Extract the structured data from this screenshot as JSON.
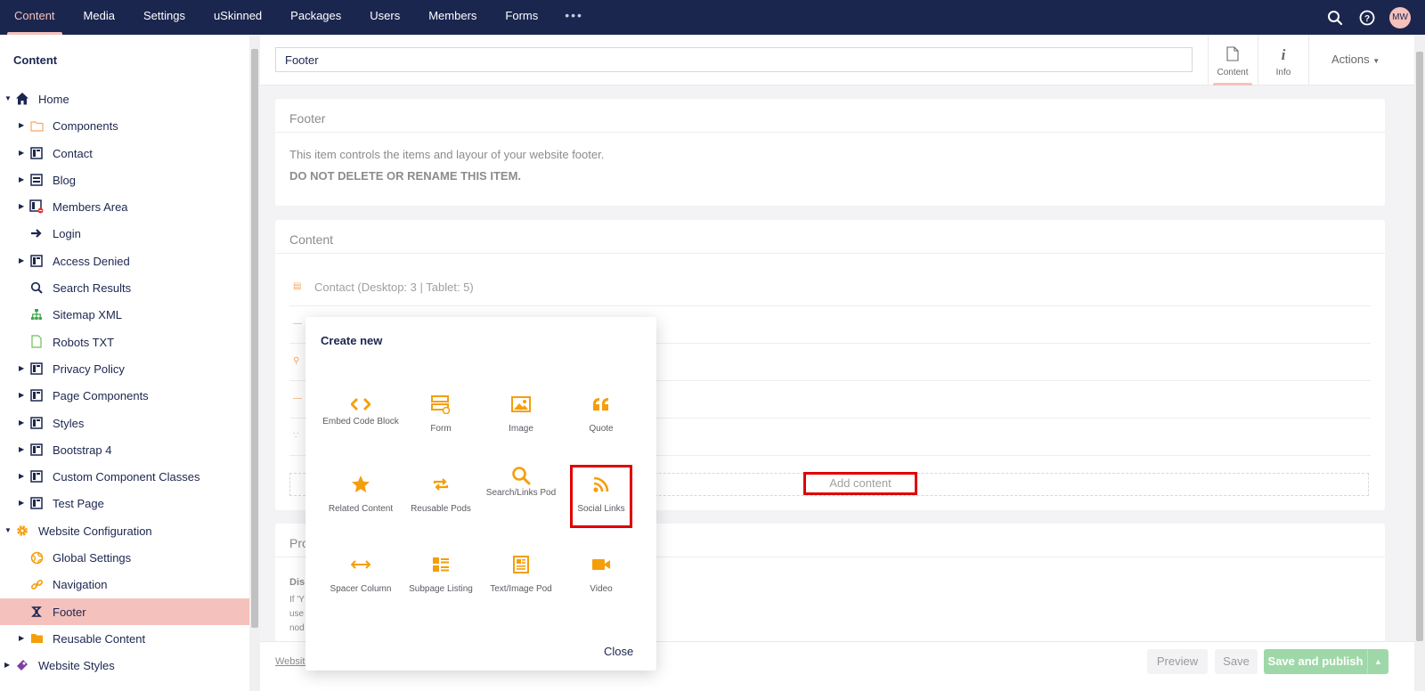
{
  "topnav": {
    "items": [
      "Content",
      "Media",
      "Settings",
      "uSkinned",
      "Packages",
      "Users",
      "Members",
      "Forms"
    ],
    "more": "•••",
    "avatar": "MW"
  },
  "sidebar": {
    "title": "Content",
    "items": [
      {
        "label": "Home",
        "icon": "home-icon"
      },
      {
        "label": "Components",
        "icon": "folder-icon"
      },
      {
        "label": "Contact",
        "icon": "page-layout-icon"
      },
      {
        "label": "Blog",
        "icon": "blog-icon"
      },
      {
        "label": "Members Area",
        "icon": "members-page-icon"
      },
      {
        "label": "Login",
        "icon": "arrow-right-icon"
      },
      {
        "label": "Access Denied",
        "icon": "page-layout-icon"
      },
      {
        "label": "Search Results",
        "icon": "search-icon"
      },
      {
        "label": "Sitemap XML",
        "icon": "sitemap-icon"
      },
      {
        "label": "Robots TXT",
        "icon": "document-icon"
      },
      {
        "label": "Privacy Policy",
        "icon": "page-layout-icon"
      },
      {
        "label": "Page Components",
        "icon": "page-layout-icon"
      },
      {
        "label": "Styles",
        "icon": "page-layout-icon"
      },
      {
        "label": "Bootstrap 4",
        "icon": "page-layout-icon"
      },
      {
        "label": "Custom Component Classes",
        "icon": "page-layout-icon"
      },
      {
        "label": "Test Page",
        "icon": "page-layout-icon"
      },
      {
        "label": "Website Configuration",
        "icon": "gear-icon"
      },
      {
        "label": "Global Settings",
        "icon": "globe-icon"
      },
      {
        "label": "Navigation",
        "icon": "link-icon"
      },
      {
        "label": "Footer",
        "icon": "footer-icon"
      },
      {
        "label": "Reusable Content",
        "icon": "folder-icon"
      },
      {
        "label": "Website Styles",
        "icon": "palette-icon"
      }
    ]
  },
  "editor": {
    "name_value": "Footer",
    "tabs": [
      {
        "label": "Content",
        "icon": "document-icon"
      },
      {
        "label": "Info",
        "icon": "info-icon"
      }
    ],
    "actions": "Actions",
    "footer_panel": {
      "title": "Footer",
      "desc": "This item controls the items and layour of your website footer.",
      "warning": "DO NOT DELETE OR RENAME THIS ITEM."
    },
    "content_panel": {
      "title": "Content",
      "first_block": "Contact (Desktop: 3 | Tablet: 5)",
      "add_content": "Add content"
    },
    "properties_panel": {
      "title": "Pro",
      "subtitle": "Dis",
      "line1": "If 'Y",
      "line2": "use",
      "line3": "nod"
    },
    "breadcrumb": "Website",
    "buttons": {
      "preview": "Preview",
      "save": "Save",
      "publish": "Save and publish"
    }
  },
  "dialog": {
    "title": "Create new",
    "items": [
      {
        "label": "Embed Code Block",
        "icon": "code-icon"
      },
      {
        "label": "Form",
        "icon": "form-icon"
      },
      {
        "label": "Image",
        "icon": "image-icon"
      },
      {
        "label": "Quote",
        "icon": "quote-icon"
      },
      {
        "label": "Related Content",
        "icon": "star-icon"
      },
      {
        "label": "Reusable Pods",
        "icon": "repeat-icon"
      },
      {
        "label": "Search/Links Pod",
        "icon": "search-icon"
      },
      {
        "label": "Social Links",
        "icon": "rss-icon"
      },
      {
        "label": "Spacer Column",
        "icon": "arrows-horizontal-icon"
      },
      {
        "label": "Subpage Listing",
        "icon": "list-icon"
      },
      {
        "label": "Text/Image Pod",
        "icon": "text-image-icon"
      },
      {
        "label": "Video",
        "icon": "video-icon"
      }
    ],
    "close": "Close"
  },
  "colors": {
    "nav_bg": "#1b264f",
    "accent": "#f5c1bc",
    "orange": "#f59e0b",
    "highlight": "#e00000",
    "publish": "#9fd8a8"
  }
}
